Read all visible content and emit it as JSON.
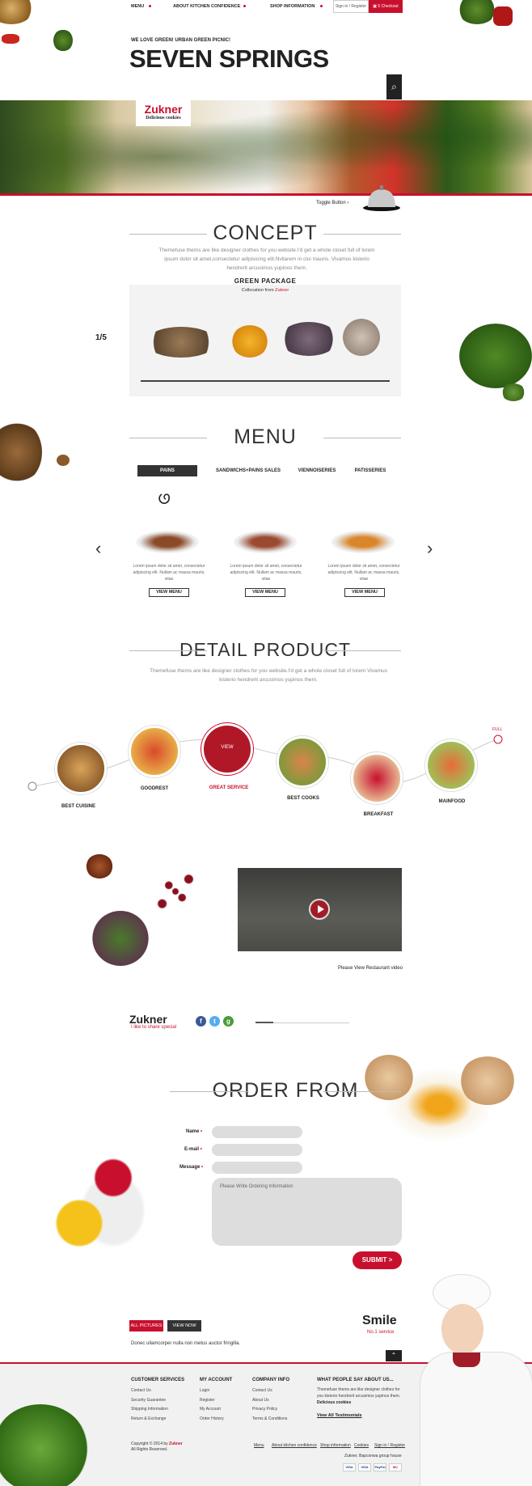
{
  "nav": {
    "items": [
      "MENU",
      "ABOUT KITCHEN CONFIDENCE",
      "SHOP INFORMATION"
    ],
    "sign": "Sign in / Register",
    "checkout_count": "5",
    "checkout": "Checkout"
  },
  "header": {
    "tagline": "WE LOVE GREEN! URBAN GREEN PICNIC!",
    "brand": "SEVEN SPRINGS"
  },
  "logo": {
    "name": "Zukner",
    "sub": "Delicious cookies"
  },
  "toggle_label": "Toggle Button",
  "concept": {
    "title": "CONCEPT",
    "desc": "Themefuse thems are like designer clothes for you website.I'd get a whole closet full of lorem ipsum dolor sit amet,consectetur adipisicing elit.Nvllarem in clui mauris. Vivamus kisterio hendrerit arcusimos yupinos them.",
    "package_title": "GREEN PACKAGE",
    "package_sub": "Collocation from",
    "package_brand": "Zukner",
    "pager": "1/5"
  },
  "menu": {
    "title": "MENU",
    "tabs": [
      "PAINS",
      "SANDWICHS+PAINS SALES",
      "VIENNOISERIES",
      "PATISSERIES"
    ],
    "item_text": "Lorem ipsum dolor sit amet, consectetur adipiscing elit. Nullam ac massa mauris, vitae",
    "view_label": "VIEW MENU"
  },
  "detail": {
    "title": "DETAIL PRODUCT",
    "desc": "Themefuse thems are like designer clothes for you website.I'd get a whole closet full of lorem Vivamus kisterio hendrerit arcusimos yupinos them.",
    "labels": [
      "BEST CUISINE",
      "GOODREST",
      "GREAT SERVICE",
      "BEST COOKS",
      "BREAKFAST",
      "MAINFOOD"
    ],
    "view": "VIEW",
    "full": "FULL"
  },
  "video_caption": "Please View Restaurant video",
  "share": {
    "brand": "Zukner",
    "sub": "I like to share special"
  },
  "order": {
    "title": "ORDER FROM",
    "name_label": "Name",
    "email_label": "E-mail",
    "message_label": "Message",
    "textarea_placeholder": "Please Write Ordering Information",
    "submit": "SUBMIT >"
  },
  "gallery": {
    "all_pictures": "ALL PICTURES",
    "view_now": "VIEW NOW",
    "donec": "Donec ullamcorper nulla non metus auctor fringilla.",
    "smile": "Smile",
    "smile_sub": "No.1 service"
  },
  "footer": {
    "customer": {
      "title": "CUSTOMER SERVICES",
      "items": [
        "Contact Us",
        "Security Guarantee",
        "Shipping Information",
        "Return & Exchange"
      ]
    },
    "account": {
      "title": "MY ACCOUNT",
      "items": [
        "Login",
        "Register",
        "My Account",
        "Order History"
      ]
    },
    "company": {
      "title": "COMPANY INFO",
      "items": [
        "Contact Us",
        "About Us",
        "Privacy Policy",
        "Terms & Conditions"
      ]
    },
    "testimonials": {
      "title": "WHAT PEOPLE SAY ABOUT US...",
      "text": "Themefuse thems are like designer clothes for you kisterio hendrerit arcusimos yupinos them.",
      "author": "Delicious cookies",
      "link": "View All Testimonials"
    },
    "copyright": "Copyright © 2014 by",
    "copyright_brand": "Zukner",
    "rights": "All Rights Reserved.",
    "links": [
      "Menu",
      "About kitchen confidence",
      "Shop information",
      "Cookies",
      "Sign in / Register"
    ],
    "corp": "Zukner, Bapconwa group house",
    "cards": [
      "VISA",
      "VISA",
      "PayPal",
      "MC"
    ]
  },
  "colors": {
    "accent": "#c8102e",
    "dark": "#222222"
  }
}
